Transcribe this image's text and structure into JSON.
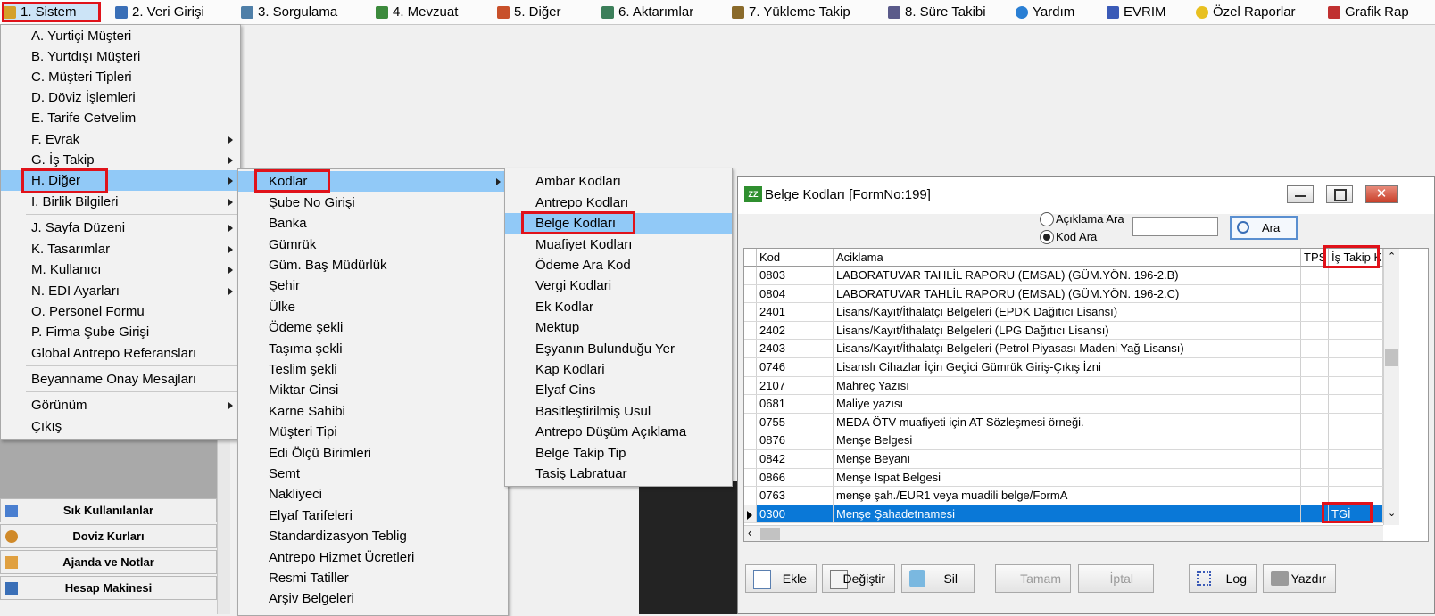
{
  "menubar": {
    "items": [
      {
        "label": "1.  Sistem",
        "color": "#d4a02a"
      },
      {
        "label": "2.  Veri Girişi",
        "color": "#3a6fb7"
      },
      {
        "label": "3.  Sorgulama",
        "color": "#4f7fa8"
      },
      {
        "label": "4.  Mevzuat",
        "color": "#3c8a3c"
      },
      {
        "label": "5.  Diğer",
        "color": "#c8502a"
      },
      {
        "label": "6.  Aktarımlar",
        "color": "#3c7f5a"
      },
      {
        "label": "7.  Yükleme Takip",
        "color": "#8a6a2a"
      },
      {
        "label": "8. Süre Takibi",
        "color": "#5a5a8a"
      },
      {
        "label": "Yardım",
        "color": "#2a7fd4"
      },
      {
        "label": "EVRIM",
        "color": "#3a5ab7"
      },
      {
        "label": "Özel Raporlar",
        "color": "#e8c020"
      },
      {
        "label": "Grafik Rap",
        "color": "#c03030"
      }
    ]
  },
  "menu_sistem": {
    "items": [
      {
        "label": "A.  Yurtiçi Müşteri"
      },
      {
        "label": "B.  Yurtdışı Müşteri"
      },
      {
        "label": "C.  Müşteri Tipleri"
      },
      {
        "label": "D.  Döviz İşlemleri"
      },
      {
        "label": "E.  Tarife Cetvelim"
      },
      {
        "label": "F.  Evrak"
      },
      {
        "label": "G.  İş Takip"
      },
      {
        "label": "H.  Diğer"
      },
      {
        "label": "I.  Birlik Bilgileri"
      },
      {
        "label": "J.  Sayfa Düzeni"
      },
      {
        "label": "K.  Tasarımlar"
      },
      {
        "label": "M.  Kullanıcı"
      },
      {
        "label": "N.  EDI Ayarları"
      },
      {
        "label": "O.  Personel Formu"
      },
      {
        "label": "P.  Firma Şube Girişi"
      },
      {
        "label": "Global Antrepo Referansları"
      },
      {
        "label": "Beyanname Onay Mesajları"
      },
      {
        "label": "Görünüm"
      },
      {
        "label": "Çıkış"
      }
    ]
  },
  "menu_diger": {
    "items": [
      "Kodlar",
      "Şube No Girişi",
      "Banka",
      "Gümrük",
      "Güm. Baş Müdürlük",
      "Şehir",
      "Ülke",
      "Ödeme şekli",
      "Taşıma şekli",
      "Teslim şekli",
      "Miktar Cinsi",
      "Karne Sahibi",
      "Müşteri  Tipi",
      "Edi Ölçü Birimleri",
      "Semt",
      "Nakliyeci",
      "Elyaf Tarifeleri",
      "Standardizasyon Teblig",
      "Antrepo Hizmet Ücretleri",
      "Resmi Tatiller",
      "Arşiv Belgeleri"
    ]
  },
  "menu_kodlar": {
    "items": [
      "Ambar Kodları",
      "Antrepo Kodları",
      "Belge Kodları",
      "Muafiyet Kodları",
      "Ödeme Ara Kod",
      "Vergi Kodlari",
      "Ek Kodlar",
      "Mektup",
      "Eşyanın Bulunduğu Yer",
      "Kap Kodlari",
      "Elyaf Cins",
      "Basitleştirilmiş Usul",
      "Antrepo Düşüm Açıklama",
      "Belge Takip Tip",
      "Tasiş Labratuar"
    ]
  },
  "quick_panel": {
    "items": [
      "Sık Kullanılanlar",
      "Doviz Kurları",
      "Ajanda ve Notlar",
      "Hesap Makinesi"
    ]
  },
  "window": {
    "title": "Belge Kodları [FormNo:199]",
    "radio_aciklama": "Açıklama Ara",
    "radio_kod": "Kod Ara",
    "search_value": "",
    "search_button": "Ara",
    "columns": [
      "Kod",
      "Aciklama",
      "TPS",
      "İş Takip K"
    ],
    "rows": [
      {
        "kod": "0803",
        "aciklama": "LABORATUVAR TAHLİL RAPORU (EMSAL) (GÜM.YÖN. 196-2.B)",
        "tps": "",
        "takip": ""
      },
      {
        "kod": "0804",
        "aciklama": "LABORATUVAR TAHLİL RAPORU (EMSAL) (GÜM.YÖN. 196-2.C)",
        "tps": "",
        "takip": ""
      },
      {
        "kod": "2401",
        "aciklama": "Lisans/Kayıt/İthalatçı Belgeleri (EPDK Dağıtıcı Lisansı)",
        "tps": "",
        "takip": ""
      },
      {
        "kod": "2402",
        "aciklama": "Lisans/Kayıt/İthalatçı Belgeleri (LPG Dağıtıcı Lisansı)",
        "tps": "",
        "takip": ""
      },
      {
        "kod": "2403",
        "aciklama": "Lisans/Kayıt/İthalatçı Belgeleri (Petrol Piyasası Madeni Yağ Lisansı)",
        "tps": "",
        "takip": ""
      },
      {
        "kod": "0746",
        "aciklama": "Lisanslı Cihazlar İçin Geçici Gümrük Giriş-Çıkış İzni",
        "tps": "",
        "takip": ""
      },
      {
        "kod": "2107",
        "aciklama": "Mahreç Yazısı",
        "tps": "",
        "takip": ""
      },
      {
        "kod": "0681",
        "aciklama": "Maliye yazısı",
        "tps": "",
        "takip": ""
      },
      {
        "kod": "0755",
        "aciklama": "MEDA ÖTV muafiyeti için AT Sözleşmesi örneği.",
        "tps": "",
        "takip": ""
      },
      {
        "kod": "0876",
        "aciklama": "Menşe Belgesi",
        "tps": "",
        "takip": ""
      },
      {
        "kod": "0842",
        "aciklama": "Menşe Beyanı",
        "tps": "",
        "takip": ""
      },
      {
        "kod": "0866",
        "aciklama": "Menşe İspat Belgesi",
        "tps": "",
        "takip": ""
      },
      {
        "kod": "0763",
        "aciklama": "menşe şah./EUR1 veya muadili belge/FormA",
        "tps": "",
        "takip": ""
      },
      {
        "kod": "0300",
        "aciklama": "Menşe Şahadetnamesi",
        "tps": "",
        "takip": "TGİ"
      }
    ],
    "buttons": {
      "ekle": "Ekle",
      "degistir": "Değiştir",
      "sil": "Sil",
      "tamam": "Tamam",
      "iptal": "İptal",
      "log": "Log",
      "yazdir": "Yazdır"
    }
  },
  "colors": {
    "highlight_red": "#e0121a",
    "menu_selection": "#91c9f7",
    "row_selection": "#0a78d7"
  }
}
